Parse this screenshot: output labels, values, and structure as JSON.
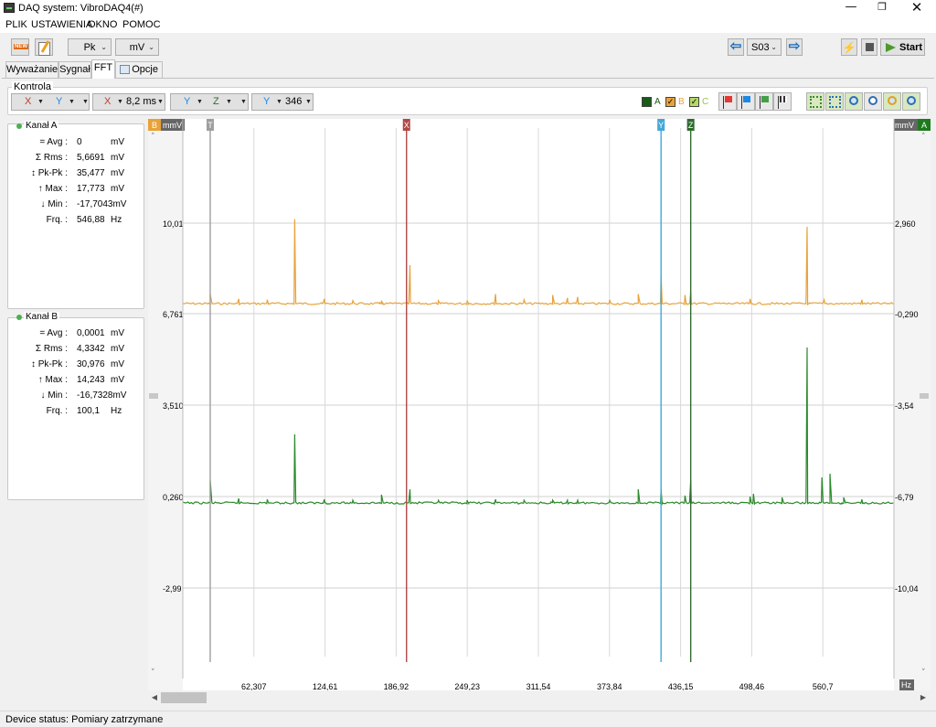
{
  "window": {
    "title": "DAQ system:  VibroDAQ4(#)",
    "min_glyph": "—",
    "max_glyph": "❐",
    "close_glyph": "✕"
  },
  "menu": [
    "PLIK",
    "USTAWIENIA",
    "OKNO",
    "POMOC"
  ],
  "toolbar": {
    "mode_select": "Pk",
    "unit_select": "mV",
    "record_select": "S03",
    "start_label": "Start"
  },
  "tabs": [
    {
      "label": "Wyważanie",
      "active": false
    },
    {
      "label": "Sygnał",
      "active": false
    },
    {
      "label": "FFT",
      "active": true
    },
    {
      "label": "Opcje",
      "active": false
    }
  ],
  "kontrola": {
    "label": "Kontrola",
    "cursor_groups": [
      {
        "items": [
          "X",
          "Y"
        ]
      },
      {
        "items": [
          "X"
        ],
        "value": "8,2 ms"
      },
      {
        "items": [
          "Y",
          "Z"
        ]
      },
      {
        "items": [
          "Y"
        ],
        "value": "346"
      }
    ],
    "channel_toggles": [
      {
        "label": "A",
        "color": "#1a5a1a",
        "checked": false
      },
      {
        "label": "B",
        "color": "#e8a23a",
        "checked": true
      },
      {
        "label": "C",
        "color": "#b5d86a",
        "checked": true
      }
    ],
    "flag_colors": [
      "#e53935",
      "#1e88e5",
      "#43a047",
      "#555555"
    ]
  },
  "channel_a": {
    "title": "Kanał A",
    "stats": [
      {
        "label": "= Avg :",
        "value": "0",
        "unit": "mV"
      },
      {
        "label": "Σ Rms :",
        "value": "5,6691",
        "unit": "mV"
      },
      {
        "label": "↕ Pk-Pk :",
        "value": "35,477",
        "unit": "mV"
      },
      {
        "label": "↑ Max :",
        "value": "17,773",
        "unit": "mV"
      },
      {
        "label": "↓ Min :",
        "value": "-17,7043mV",
        "unit": ""
      },
      {
        "label": "Frq. :",
        "value": "546,88",
        "unit": "Hz"
      }
    ]
  },
  "channel_b": {
    "title": "Kanał B",
    "stats": [
      {
        "label": "= Avg :",
        "value": "0,0001",
        "unit": "mV"
      },
      {
        "label": "Σ Rms :",
        "value": "4,3342",
        "unit": "mV"
      },
      {
        "label": "↕ Pk-Pk :",
        "value": "30,976",
        "unit": "mV"
      },
      {
        "label": "↑ Max :",
        "value": "14,243",
        "unit": "mV"
      },
      {
        "label": "↓ Min :",
        "value": "-16,7328mV",
        "unit": ""
      },
      {
        "label": "Frq. :",
        "value": "100,1",
        "unit": "Hz"
      }
    ]
  },
  "chart_data": {
    "type": "line",
    "left_axis": {
      "badge": "B",
      "unit": "mmV",
      "badge_color": "#e8a23a",
      "ticks": [
        "10,01",
        "6,761",
        "3,510",
        "0,260",
        "-2,99"
      ]
    },
    "right_axis": {
      "badge": "A",
      "unit": "mmV",
      "badge_color": "#1e7a1e",
      "ticks": [
        "2,960",
        "-0,290",
        "-3,54",
        "-6,79",
        "-10,04"
      ]
    },
    "x_unit": "Hz",
    "x_ticks": [
      "62,307",
      "124,61",
      "186,92",
      "249,23",
      "311,54",
      "373,84",
      "436,15",
      "498,46",
      "560,7"
    ],
    "x_range": [
      0,
      623.07
    ],
    "cursor_markers": [
      {
        "label": "T",
        "x": 24,
        "color": "#9e9e9e"
      },
      {
        "label": "X",
        "x": 196,
        "color": "#b04848"
      },
      {
        "label": "Y",
        "x": 419,
        "color": "#42a8d8"
      },
      {
        "label": "Z",
        "x": 445,
        "color": "#2e6b2e"
      }
    ],
    "series": [
      {
        "color": "#e8a23a",
        "peaks": [
          [
            24,
            1.0
          ],
          [
            49,
            0.5
          ],
          [
            74,
            0.4
          ],
          [
            98,
            8.8
          ],
          [
            124,
            0.5
          ],
          [
            149,
            0.3
          ],
          [
            174,
            0.3
          ],
          [
            199,
            4.0
          ],
          [
            224,
            0.3
          ],
          [
            249,
            0.3
          ],
          [
            274,
            1.0
          ],
          [
            299,
            0.4
          ],
          [
            324,
            0.9
          ],
          [
            337,
            0.6
          ],
          [
            346,
            0.7
          ],
          [
            374,
            0.4
          ],
          [
            399,
            1.0
          ],
          [
            419,
            3.0
          ],
          [
            440,
            0.9
          ],
          [
            445,
            1.2
          ],
          [
            497,
            0.5
          ],
          [
            547,
            8.0
          ],
          [
            562,
            0.4
          ],
          [
            595,
            0.4
          ]
        ],
        "baseline": 7.0
      },
      {
        "color": "#2a8a2a",
        "peaks": [
          [
            24,
            2.5
          ],
          [
            49,
            0.5
          ],
          [
            74,
            0.4
          ],
          [
            98,
            7.5
          ],
          [
            124,
            0.4
          ],
          [
            149,
            0.3
          ],
          [
            174,
            0.9
          ],
          [
            199,
            1.5
          ],
          [
            224,
            0.3
          ],
          [
            249,
            0.3
          ],
          [
            274,
            0.4
          ],
          [
            299,
            0.3
          ],
          [
            324,
            0.3
          ],
          [
            337,
            0.3
          ],
          [
            346,
            0.3
          ],
          [
            374,
            0.3
          ],
          [
            399,
            1.5
          ],
          [
            419,
            1.5
          ],
          [
            440,
            0.8
          ],
          [
            445,
            2.5
          ],
          [
            497,
            0.7
          ],
          [
            500,
            1.0
          ],
          [
            525,
            0.6
          ],
          [
            547,
            17.0
          ],
          [
            560,
            2.8
          ],
          [
            567,
            3.2
          ],
          [
            579,
            0.6
          ],
          [
            595,
            0.4
          ]
        ],
        "baseline": 0.0
      }
    ]
  },
  "status": {
    "text": "Device status: Pomiary zatrzymane"
  }
}
